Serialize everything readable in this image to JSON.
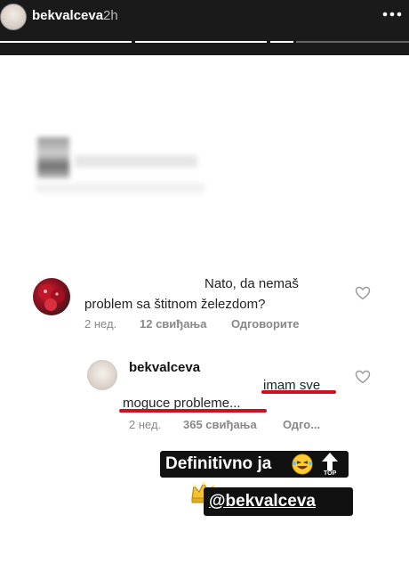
{
  "header": {
    "username": "bekvalceva",
    "time": "2h",
    "more_icon": "more-dots-icon",
    "progress_segments": 4,
    "active_segment": 3
  },
  "comment": {
    "text_line1": "Nato, da nemaš",
    "text_line2": "problem sa štitnom železdom?",
    "age": "2 нед.",
    "likes": "12 свиђања",
    "reply": "Одговорите"
  },
  "reply": {
    "username": "bekvalceva",
    "text_part1": "imam sve",
    "text_part2": "moguce probleme...",
    "age": "2 нед.",
    "likes": "365 свиђања",
    "reply": "Одго..."
  },
  "stickers": {
    "line1": "Definitivno ja",
    "line2": "@bekvalceva",
    "top_badge": "TOP"
  },
  "colors": {
    "underline": "#d10f1f",
    "header_bg": "#1a1a1a",
    "sticker_bg": "#111111"
  }
}
